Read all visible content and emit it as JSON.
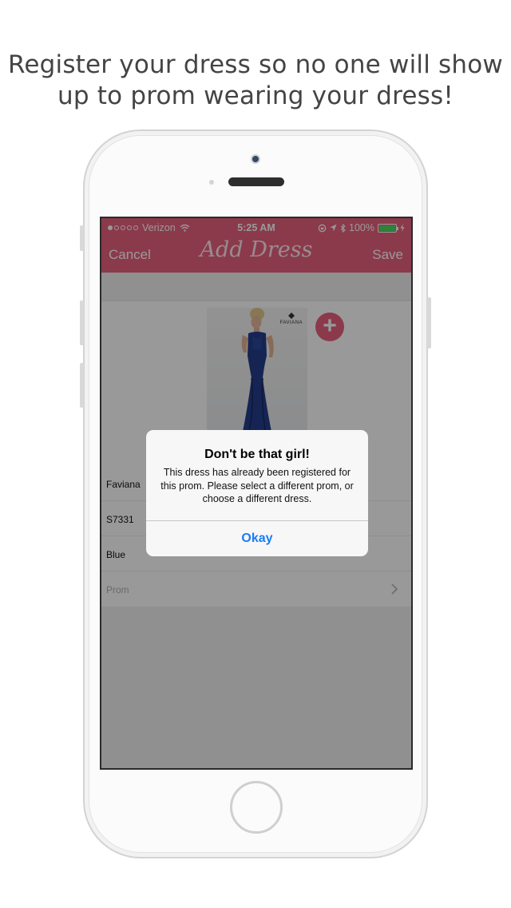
{
  "headline": {
    "line1": "Register your dress so no one will show",
    "line2": "up to prom wearing your dress!"
  },
  "status_bar": {
    "carrier": "Verizon",
    "time": "5:25 AM",
    "battery": "100%"
  },
  "navbar": {
    "cancel_label": "Cancel",
    "title": "Add Dress",
    "save_label": "Save",
    "color": "#e8617e"
  },
  "dress": {
    "brand_logo_text": "FAVIANA",
    "add_button": "+"
  },
  "fields": {
    "brand": "Faviana",
    "style": "S7331",
    "color": "Blue",
    "prom_placeholder": "Prom"
  },
  "alert": {
    "title": "Don't be that girl!",
    "message": "This dress has already been registered for this prom. Please select a different prom, or choose a different dress.",
    "ok_label": "Okay"
  }
}
